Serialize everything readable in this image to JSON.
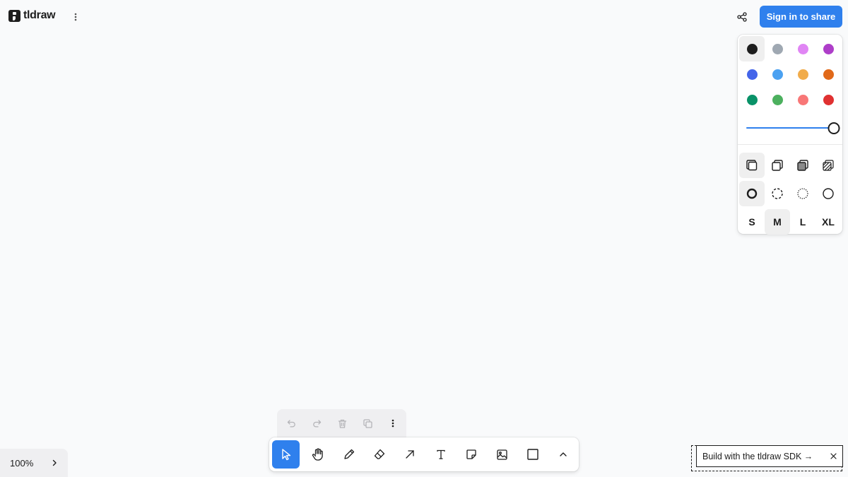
{
  "header": {
    "logo_text": "tldraw",
    "signin_label": "Sign in to share"
  },
  "style_panel": {
    "colors": [
      {
        "name": "black",
        "hex": "#1d1d1d",
        "selected": true
      },
      {
        "name": "grey",
        "hex": "#9fa8b2",
        "selected": false
      },
      {
        "name": "light-violet",
        "hex": "#e085f4",
        "selected": false
      },
      {
        "name": "violet",
        "hex": "#ae3ec9",
        "selected": false
      },
      {
        "name": "blue",
        "hex": "#4465e9",
        "selected": false
      },
      {
        "name": "light-blue",
        "hex": "#4ba1f1",
        "selected": false
      },
      {
        "name": "yellow",
        "hex": "#f1ac4b",
        "selected": false
      },
      {
        "name": "orange",
        "hex": "#e16919",
        "selected": false
      },
      {
        "name": "green",
        "hex": "#099268",
        "selected": false
      },
      {
        "name": "light-green",
        "hex": "#4cb05e",
        "selected": false
      },
      {
        "name": "light-red",
        "hex": "#f87777",
        "selected": false
      },
      {
        "name": "red",
        "hex": "#e03131",
        "selected": false
      }
    ],
    "opacity": 1.0,
    "fill_options": [
      {
        "icon": "fill-none-icon",
        "selected": true
      },
      {
        "icon": "fill-semi-icon",
        "selected": false
      },
      {
        "icon": "fill-solid-icon",
        "selected": false
      },
      {
        "icon": "fill-pattern-icon",
        "selected": false
      }
    ],
    "dash_options": [
      {
        "icon": "dash-draw-icon",
        "selected": true
      },
      {
        "icon": "dash-dashed-icon",
        "selected": false
      },
      {
        "icon": "dash-dotted-icon",
        "selected": false
      },
      {
        "icon": "dash-solid-icon",
        "selected": false
      }
    ],
    "sizes": [
      {
        "label": "S",
        "selected": false
      },
      {
        "label": "M",
        "selected": true
      },
      {
        "label": "L",
        "selected": false
      },
      {
        "label": "XL",
        "selected": false
      }
    ]
  },
  "quick_actions": [
    "undo-icon",
    "redo-icon",
    "trash-icon",
    "duplicate-icon",
    "more-vertical-icon"
  ],
  "toolbar": {
    "tools": [
      {
        "icon": "select-icon",
        "active": true
      },
      {
        "icon": "hand-icon",
        "active": false
      },
      {
        "icon": "draw-icon",
        "active": false
      },
      {
        "icon": "eraser-icon",
        "active": false
      },
      {
        "icon": "arrow-icon",
        "active": false
      },
      {
        "icon": "text-icon",
        "active": false
      },
      {
        "icon": "note-icon",
        "active": false
      },
      {
        "icon": "image-icon",
        "active": false
      },
      {
        "icon": "rectangle-icon",
        "active": false
      },
      {
        "icon": "chevron-up-icon",
        "active": false
      }
    ]
  },
  "zoom": {
    "value": "100%"
  },
  "sdk_banner": {
    "label": "Build with the tldraw SDK →"
  },
  "accent_color": "#2f80ed"
}
